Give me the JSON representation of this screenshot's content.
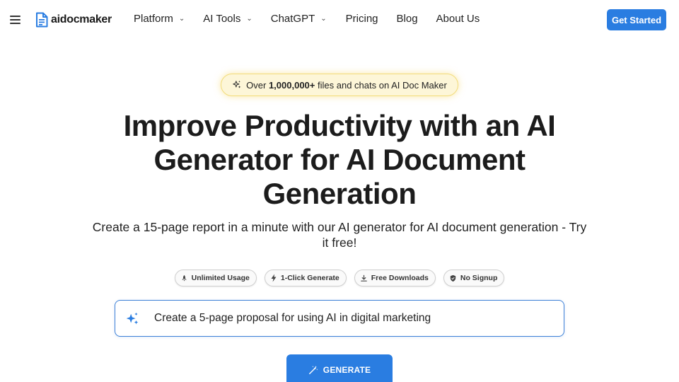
{
  "header": {
    "logo_text": "aidocmaker",
    "nav": [
      {
        "label": "Platform",
        "has_dropdown": true
      },
      {
        "label": "AI Tools",
        "has_dropdown": true
      },
      {
        "label": "ChatGPT",
        "has_dropdown": true
      },
      {
        "label": "Pricing",
        "has_dropdown": false
      },
      {
        "label": "Blog",
        "has_dropdown": false
      },
      {
        "label": "About Us",
        "has_dropdown": false
      }
    ],
    "cta_label": "Get Started"
  },
  "badge": {
    "prefix": "Over",
    "count": "1,000,000+",
    "suffix": "files and chats on AI Doc Maker"
  },
  "hero": {
    "title": "Improve Productivity with an AI Generator for AI Document Generation",
    "subtitle": "Create a 15-page report in a minute with our AI generator for AI document generation - Try it free!"
  },
  "features": [
    {
      "label": "Unlimited Usage",
      "icon": "rocket-icon"
    },
    {
      "label": "1-Click Generate",
      "icon": "bolt-icon"
    },
    {
      "label": "Free Downloads",
      "icon": "download-icon"
    },
    {
      "label": "No Signup",
      "icon": "shield-check-icon"
    }
  ],
  "prompt": {
    "value": "Create a 5-page proposal for using AI in digital marketing",
    "icon": "sparkles-icon"
  },
  "generate": {
    "label": "GENERATE",
    "icon": "magic-wand-icon"
  },
  "colors": {
    "primary": "#2a7de1",
    "badge_bg": "#fdf6d8",
    "badge_border": "#f2dc7a",
    "text": "#1c1c1c"
  }
}
